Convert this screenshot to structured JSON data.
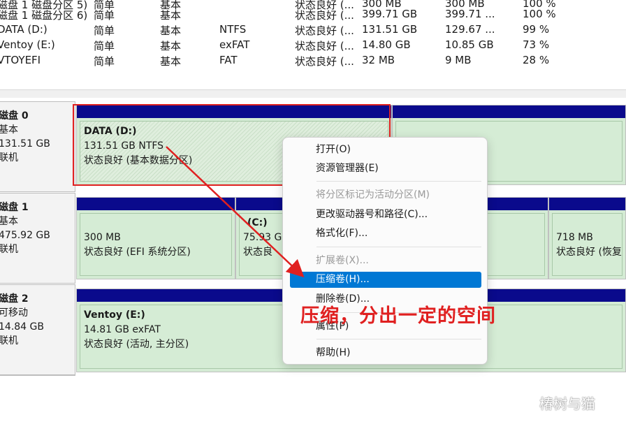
{
  "volume_table": {
    "rows": [
      {
        "name": "磁盘 1 磁盘分区 5)",
        "layout": "简单",
        "type": "基本",
        "fs": "",
        "status": "状态良好 (...",
        "capacity": "300 MB",
        "free": "300 MB",
        "pct": "100 %"
      },
      {
        "name": "磁盘 1 磁盘分区 6)",
        "layout": "简单",
        "type": "基本",
        "fs": "",
        "status": "状态良好 (...",
        "capacity": "399.71 GB",
        "free": "399.71 ...",
        "pct": "100 %"
      },
      {
        "name": "DATA (D:)",
        "layout": "简单",
        "type": "基本",
        "fs": "NTFS",
        "status": "状态良好 (...",
        "capacity": "131.51 GB",
        "free": "129.67 ...",
        "pct": "99 %"
      },
      {
        "name": "Ventoy (E:)",
        "layout": "简单",
        "type": "基本",
        "fs": "exFAT",
        "status": "状态良好 (...",
        "capacity": "14.80 GB",
        "free": "10.85 GB",
        "pct": "73 %"
      },
      {
        "name": "VTOYEFI",
        "layout": "简单",
        "type": "基本",
        "fs": "FAT",
        "status": "状态良好 (...",
        "capacity": "32 MB",
        "free": "9 MB",
        "pct": "28 %"
      }
    ]
  },
  "disks": [
    {
      "title": "磁盘 0",
      "kind": "基本",
      "size": "131.51 GB",
      "state": "联机"
    },
    {
      "title": "磁盘 1",
      "kind": "基本",
      "size": "475.92 GB",
      "state": "联机"
    },
    {
      "title": "磁盘 2",
      "kind": "可移动",
      "size": "14.84 GB",
      "state": "联机"
    }
  ],
  "partitions": {
    "d0_data": {
      "name": "DATA  (D:)",
      "size": "131.51 GB NTFS",
      "status": "状态良好 (基本数据分区)"
    },
    "d1_efi": {
      "size": "300 MB",
      "status": "状态良好 (EFI 系统分区)"
    },
    "d1_c": {
      "name": "(C:)",
      "size": "75.93 GB",
      "status": "状态良"
    },
    "d1_recovery": {
      "size": "718 MB",
      "status": "状态良好 (恢复"
    },
    "d2_ventoy": {
      "name": "Ventoy  (E:)",
      "size": "14.81 GB exFAT",
      "status": "状态良好 (活动, 主分区)"
    }
  },
  "context_menu": {
    "items": [
      {
        "label": "打开(O)",
        "enabled": true
      },
      {
        "label": "资源管理器(E)",
        "enabled": true
      },
      {
        "label": "将分区标记为活动分区(M)",
        "enabled": false
      },
      {
        "label": "更改驱动器号和路径(C)...",
        "enabled": true
      },
      {
        "label": "格式化(F)...",
        "enabled": true
      },
      {
        "label": "扩展卷(X)...",
        "enabled": false
      },
      {
        "label": "压缩卷(H)...",
        "enabled": true,
        "selected": true
      },
      {
        "label": "删除卷(D)...",
        "enabled": true
      },
      {
        "label": "属性(P)",
        "enabled": true
      },
      {
        "label": "帮助(H)",
        "enabled": true
      }
    ]
  },
  "annotation": {
    "text": "压缩，分出一定的空间",
    "color": "#e02020"
  },
  "watermark": {
    "text": "椿树与猫"
  },
  "colors": {
    "partition_bar": "#0a0a8c",
    "partition_fill": "#d4ebd4",
    "selection": "#0078d4",
    "highlight": "#e02020"
  }
}
